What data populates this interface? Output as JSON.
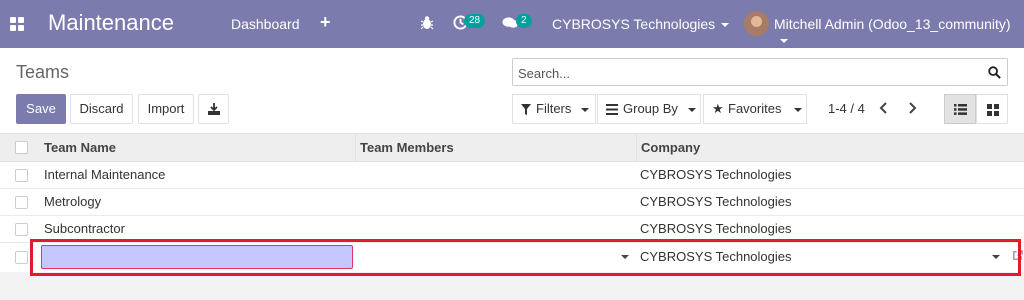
{
  "navbar": {
    "app_title": "Maintenance",
    "menu_dashboard": "Dashboard",
    "plus_symbol": "+",
    "activity_badge": "28",
    "messages_badge": "2",
    "company": "CYBROSYS Technologies",
    "user": "Mitchell Admin (Odoo_13_community)",
    "icons": [
      "apps-grid-icon",
      "plus-icon",
      "bug-icon",
      "activity-clock-icon",
      "chat-icon",
      "avatar"
    ]
  },
  "control": {
    "title": "Teams",
    "search_placeholder": "Search...",
    "save_label": "Save",
    "discard_label": "Discard",
    "import_label": "Import",
    "filters_label": "Filters",
    "groupby_label": "Group By",
    "favorites_label": "Favorites",
    "pager": "1-4 / 4"
  },
  "table": {
    "columns": [
      "Team Name",
      "Team Members",
      "Company"
    ],
    "rows": [
      {
        "name": "Internal Maintenance",
        "members": "",
        "company": "CYBROSYS Technologies"
      },
      {
        "name": "Metrology",
        "members": "",
        "company": "CYBROSYS Technologies"
      },
      {
        "name": "Subcontractor",
        "members": "",
        "company": "CYBROSYS Technologies"
      }
    ],
    "edit_row": {
      "name": "",
      "members": "",
      "company": "CYBROSYS Technologies"
    }
  },
  "colors": {
    "brand": "#7c7bad",
    "badge": "#00a09d",
    "highlight": "#e21b2c",
    "input_bg": "#c7c7ff"
  }
}
